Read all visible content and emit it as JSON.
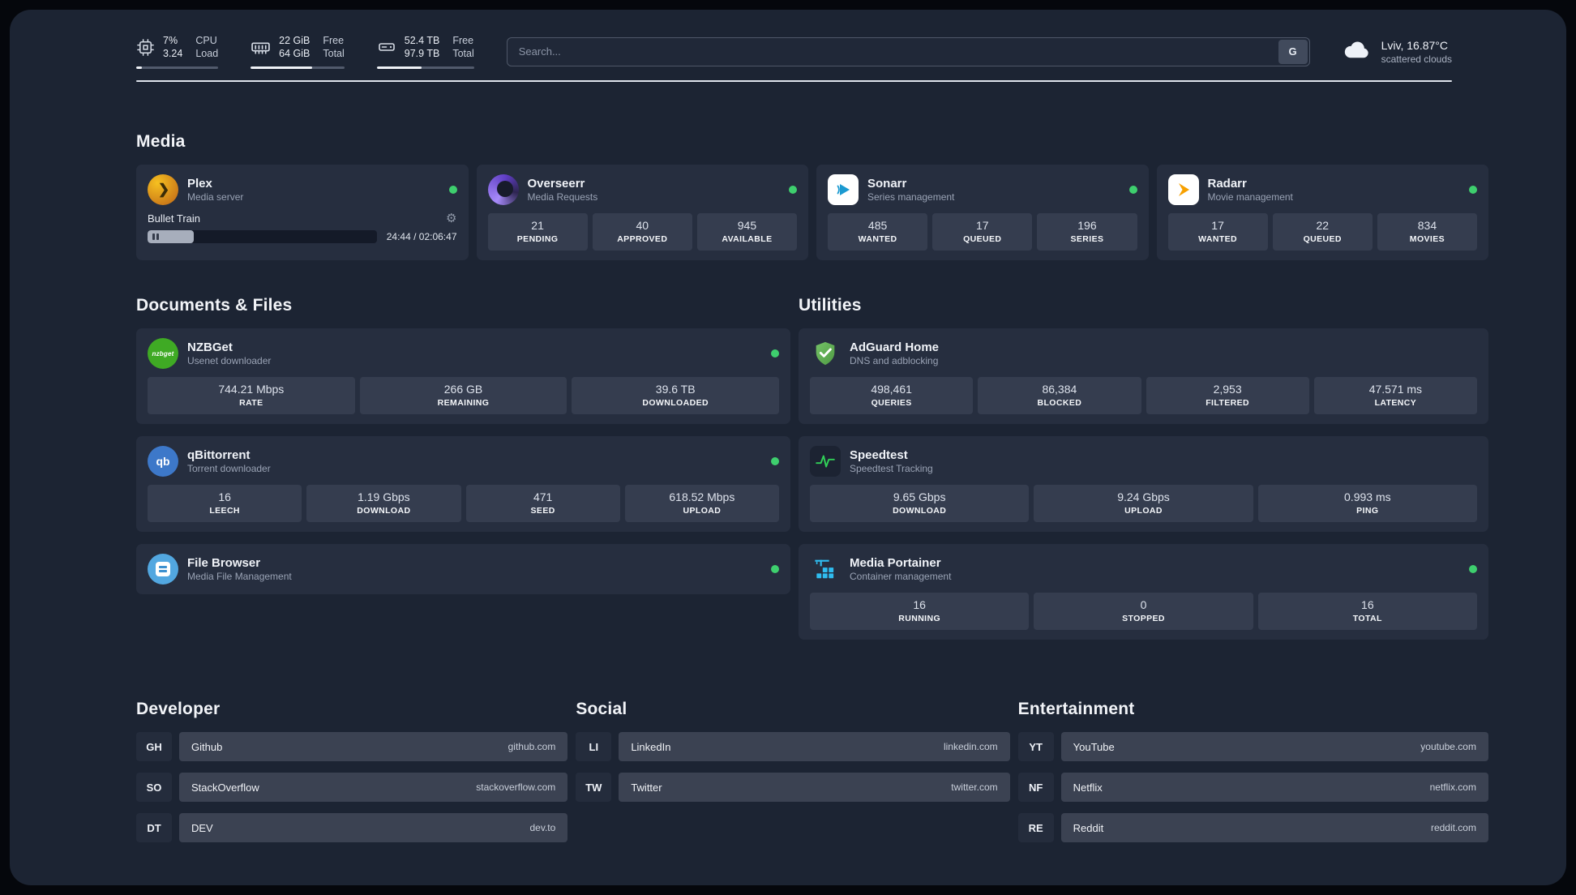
{
  "colors": {
    "status_online": "#3ecf6e"
  },
  "topbar": {
    "cpu": {
      "value_top": "7%",
      "value_bottom": "3.24",
      "label_top": "CPU",
      "label_bottom": "Load",
      "fill_percent": 7
    },
    "ram": {
      "value_top": "22 GiB",
      "value_bottom": "64 GiB",
      "label_top": "Free",
      "label_bottom": "Total",
      "fill_percent": 66
    },
    "disk": {
      "value_top": "52.4 TB",
      "value_bottom": "97.9 TB",
      "label_top": "Free",
      "label_bottom": "Total",
      "fill_percent": 46
    },
    "search": {
      "placeholder": "Search...",
      "button": "G"
    },
    "weather": {
      "location": "Lviv, 16.87°C",
      "condition": "scattered clouds"
    }
  },
  "media": {
    "title": "Media",
    "plex": {
      "name": "Plex",
      "subtitle": "Media server",
      "now_playing": {
        "title": "Bullet Train",
        "time": "24:44 / 02:06:47",
        "progress_percent": 20
      }
    },
    "overseerr": {
      "name": "Overseerr",
      "subtitle": "Media Requests",
      "stats": [
        {
          "value": "21",
          "label": "PENDING"
        },
        {
          "value": "40",
          "label": "APPROVED"
        },
        {
          "value": "945",
          "label": "AVAILABLE"
        }
      ]
    },
    "sonarr": {
      "name": "Sonarr",
      "subtitle": "Series management",
      "stats": [
        {
          "value": "485",
          "label": "WANTED"
        },
        {
          "value": "17",
          "label": "QUEUED"
        },
        {
          "value": "196",
          "label": "SERIES"
        }
      ]
    },
    "radarr": {
      "name": "Radarr",
      "subtitle": "Movie management",
      "stats": [
        {
          "value": "17",
          "label": "WANTED"
        },
        {
          "value": "22",
          "label": "QUEUED"
        },
        {
          "value": "834",
          "label": "MOVIES"
        }
      ]
    }
  },
  "documents": {
    "title": "Documents & Files",
    "nzbget": {
      "name": "NZBGet",
      "subtitle": "Usenet downloader",
      "stats": [
        {
          "value": "744.21 Mbps",
          "label": "RATE"
        },
        {
          "value": "266 GB",
          "label": "REMAINING"
        },
        {
          "value": "39.6 TB",
          "label": "DOWNLOADED"
        }
      ]
    },
    "qbittorrent": {
      "name": "qBittorrent",
      "subtitle": "Torrent downloader",
      "stats": [
        {
          "value": "16",
          "label": "LEECH"
        },
        {
          "value": "1.19 Gbps",
          "label": "DOWNLOAD"
        },
        {
          "value": "471",
          "label": "SEED"
        },
        {
          "value": "618.52 Mbps",
          "label": "UPLOAD"
        }
      ]
    },
    "filebrowser": {
      "name": "File Browser",
      "subtitle": "Media File Management"
    }
  },
  "utilities": {
    "title": "Utilities",
    "adguard": {
      "name": "AdGuard Home",
      "subtitle": "DNS and adblocking",
      "stats": [
        {
          "value": "498,461",
          "label": "QUERIES"
        },
        {
          "value": "86,384",
          "label": "BLOCKED"
        },
        {
          "value": "2,953",
          "label": "FILTERED"
        },
        {
          "value": "47.571 ms",
          "label": "LATENCY"
        }
      ]
    },
    "speedtest": {
      "name": "Speedtest",
      "subtitle": "Speedtest Tracking",
      "stats": [
        {
          "value": "9.65 Gbps",
          "label": "DOWNLOAD"
        },
        {
          "value": "9.24 Gbps",
          "label": "UPLOAD"
        },
        {
          "value": "0.993 ms",
          "label": "PING"
        }
      ]
    },
    "portainer": {
      "name": "Media Portainer",
      "subtitle": "Container management",
      "stats": [
        {
          "value": "16",
          "label": "RUNNING"
        },
        {
          "value": "0",
          "label": "STOPPED"
        },
        {
          "value": "16",
          "label": "TOTAL"
        }
      ]
    }
  },
  "bookmarks": {
    "developer": {
      "title": "Developer",
      "items": [
        {
          "abbr": "GH",
          "name": "Github",
          "url": "github.com"
        },
        {
          "abbr": "SO",
          "name": "StackOverflow",
          "url": "stackoverflow.com"
        },
        {
          "abbr": "DT",
          "name": "DEV",
          "url": "dev.to"
        }
      ]
    },
    "social": {
      "title": "Social",
      "items": [
        {
          "abbr": "LI",
          "name": "LinkedIn",
          "url": "linkedin.com"
        },
        {
          "abbr": "TW",
          "name": "Twitter",
          "url": "twitter.com"
        }
      ]
    },
    "entertainment": {
      "title": "Entertainment",
      "items": [
        {
          "abbr": "YT",
          "name": "YouTube",
          "url": "youtube.com"
        },
        {
          "abbr": "NF",
          "name": "Netflix",
          "url": "netflix.com"
        },
        {
          "abbr": "RE",
          "name": "Reddit",
          "url": "reddit.com"
        }
      ]
    }
  }
}
